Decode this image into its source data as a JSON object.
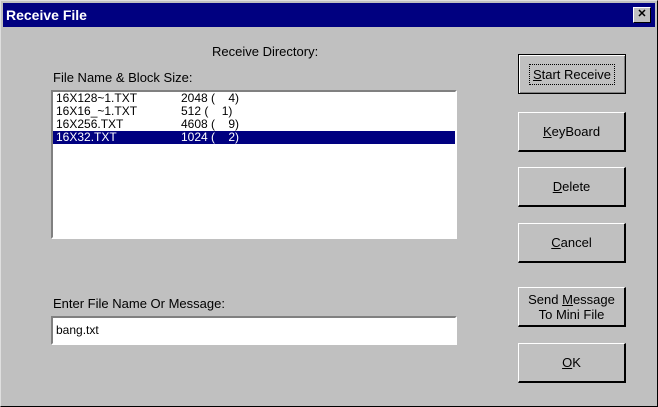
{
  "window": {
    "title": "Receive File",
    "close_glyph": "✕"
  },
  "labels": {
    "receive_directory": "Receive Directory:",
    "file_list": "File Name & Block Size:",
    "enter_name": "Enter File Name Or Message:"
  },
  "files": [
    {
      "name": "16X128~1.TXT",
      "size": "2048 (    4)",
      "selected": false
    },
    {
      "name": "16X16_~1.TXT",
      "size": "512 (    1)",
      "selected": false
    },
    {
      "name": "16X256.TXT",
      "size": "4608 (    9)",
      "selected": false
    },
    {
      "name": "16X32.TXT",
      "size": "1024 (    2)",
      "selected": true
    }
  ],
  "input": {
    "value": "bang.txt"
  },
  "buttons": {
    "start_receive": {
      "mnemonic": "S",
      "rest": "tart Receive"
    },
    "keyboard": {
      "mnemonic": "K",
      "rest": "eyBoard"
    },
    "delete": {
      "mnemonic": "D",
      "rest": "elete"
    },
    "cancel": {
      "mnemonic": "C",
      "rest": "ancel"
    },
    "send_message": {
      "pre": "Send ",
      "mnemonic": "M",
      "rest": "essage",
      "line2": "To Mini File"
    },
    "ok": {
      "mnemonic": "O",
      "rest": "K"
    }
  }
}
